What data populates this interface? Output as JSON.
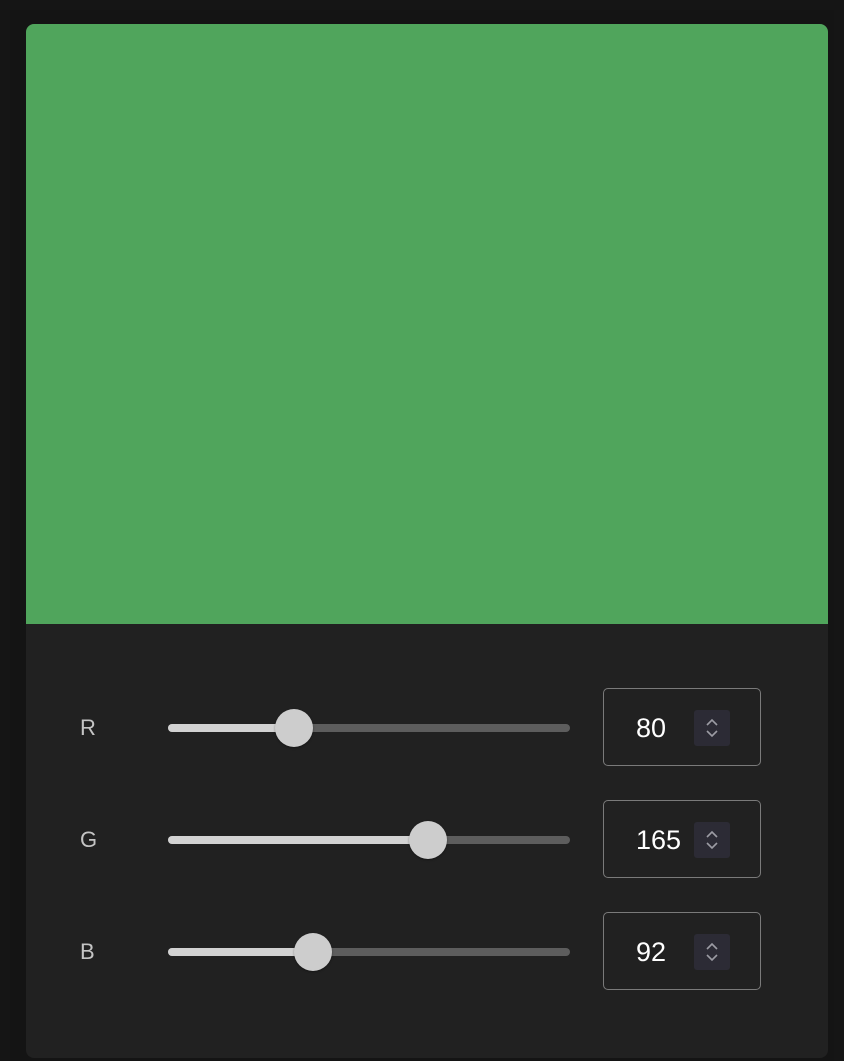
{
  "preview": {
    "color": "#50a55c"
  },
  "channels": [
    {
      "label": "R",
      "value": "80",
      "max": 255
    },
    {
      "label": "G",
      "value": "165",
      "max": 255
    },
    {
      "label": "B",
      "value": "92",
      "max": 255
    }
  ],
  "icons": {
    "spinner": "chevron-up-down-icon"
  }
}
